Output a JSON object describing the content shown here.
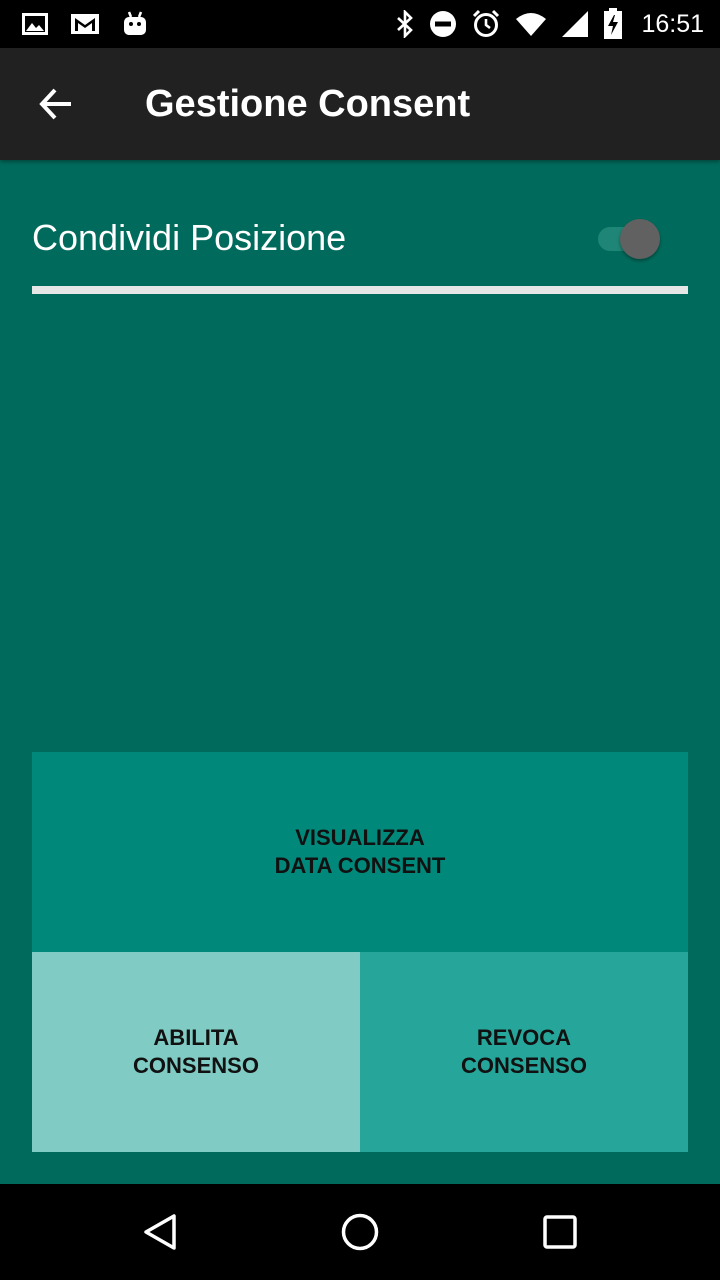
{
  "status_bar": {
    "time": "16:51",
    "left_icons": [
      "image-notification-icon",
      "gmail-notification-icon",
      "android-notification-icon"
    ],
    "right_icons": [
      "bluetooth-icon",
      "do-not-disturb-icon",
      "alarm-icon",
      "wifi-icon",
      "cellular-signal-icon",
      "battery-charging-icon"
    ]
  },
  "app_bar": {
    "title": "Gestione Consent",
    "back_icon": "arrow-back-icon"
  },
  "settings": {
    "share_location_label": "Condividi Posizione",
    "share_location_enabled": false
  },
  "buttons": {
    "view_consent_date": "VISUALIZZA\nDATA CONSENT",
    "enable_consent": "ABILITA\nCONSENSO",
    "revoke_consent": "REVOCA\nCONSENSO"
  },
  "nav_bar": {
    "icons": [
      "back-triangle-icon",
      "home-circle-icon",
      "recents-square-icon"
    ]
  },
  "colors": {
    "background": "#006b5c",
    "app_bar": "#212121",
    "btn_view": "#00897b",
    "btn_enable": "#80cbc4",
    "btn_revoke": "#26a69a"
  }
}
